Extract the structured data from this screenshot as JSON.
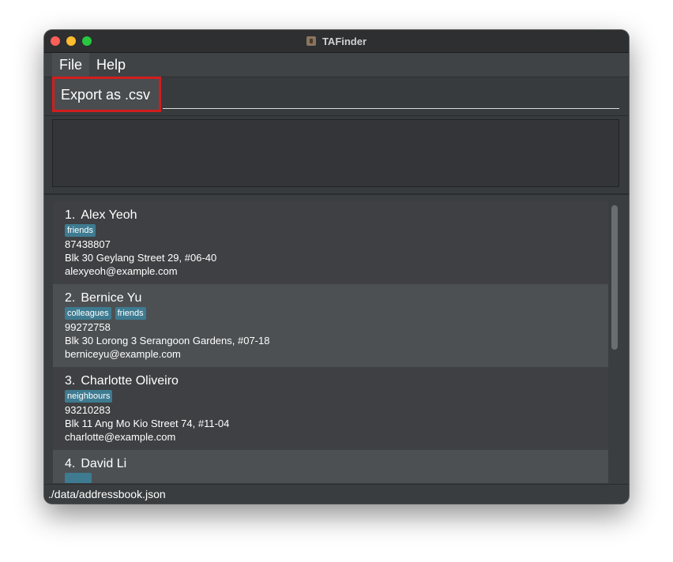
{
  "window": {
    "title": "TAFinder"
  },
  "menu": {
    "file": "File",
    "help": "Help"
  },
  "file_menu": {
    "export_label": "Export as .csv"
  },
  "result_display": {
    "text": ""
  },
  "persons": [
    {
      "index": "1.",
      "name": "Alex Yeoh",
      "tags": [
        "friends"
      ],
      "phone": "87438807",
      "address": "Blk 30 Geylang Street 29, #06-40",
      "email": "alexyeoh@example.com"
    },
    {
      "index": "2.",
      "name": "Bernice Yu",
      "tags": [
        "colleagues",
        "friends"
      ],
      "phone": "99272758",
      "address": "Blk 30 Lorong 3 Serangoon Gardens, #07-18",
      "email": "berniceyu@example.com"
    },
    {
      "index": "3.",
      "name": "Charlotte Oliveiro",
      "tags": [
        "neighbours"
      ],
      "phone": "93210283",
      "address": "Blk 11 Ang Mo Kio Street 74, #11-04",
      "email": "charlotte@example.com"
    },
    {
      "index": "4.",
      "name": "David Li",
      "tags": [],
      "phone": "",
      "address": "",
      "email": ""
    }
  ],
  "status_bar": {
    "path": "./data/addressbook.json"
  },
  "colors": {
    "accent_red": "#d11d1d",
    "tag_bg": "#3e7b91",
    "window_bg": "#3b3e41"
  }
}
